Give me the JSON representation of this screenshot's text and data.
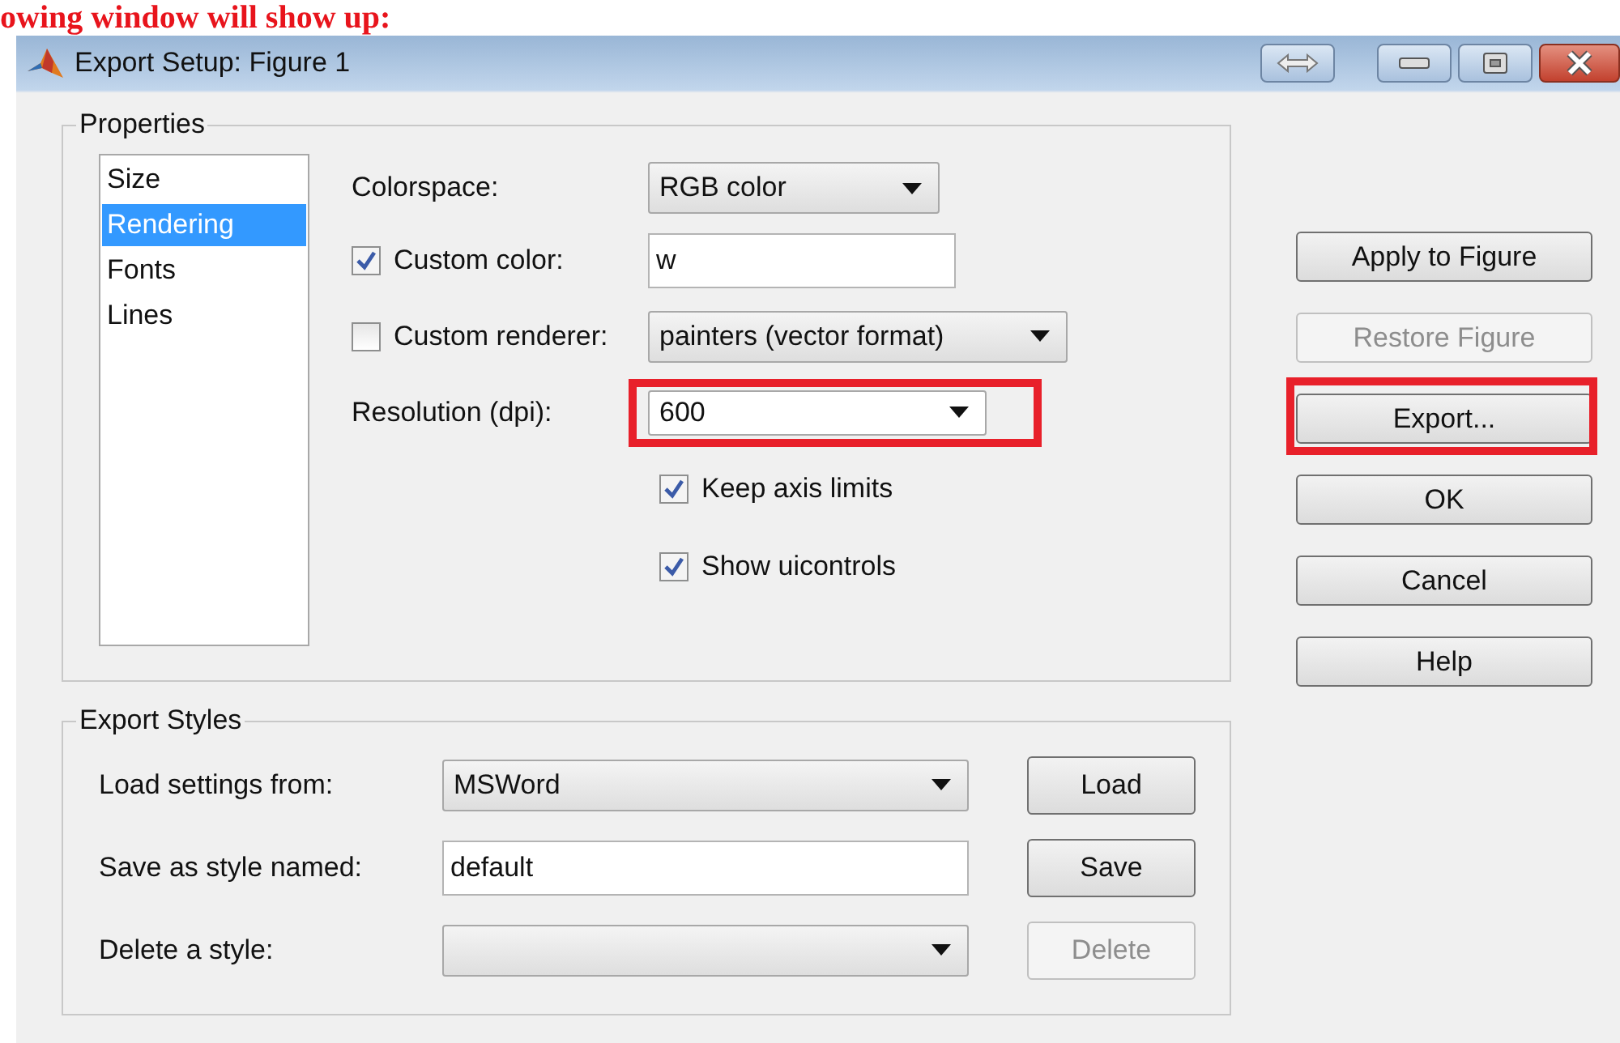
{
  "caption": "owing window will show up:",
  "window": {
    "title": "Export Setup: Figure 1"
  },
  "properties": {
    "title": "Properties",
    "categories": [
      {
        "label": "Size",
        "selected": false
      },
      {
        "label": "Rendering",
        "selected": true
      },
      {
        "label": "Fonts",
        "selected": false
      },
      {
        "label": "Lines",
        "selected": false
      }
    ],
    "fields": [
      {
        "kind": "dropdown",
        "label": "Colorspace:",
        "value": "RGB color",
        "highlighted": false
      },
      {
        "kind": "checkbox-text",
        "label": "Custom color:",
        "checked": true,
        "value": "w",
        "highlighted": false
      },
      {
        "kind": "checkbox-dropdown",
        "label": "Custom renderer:",
        "checked": false,
        "value": "painters (vector format)",
        "highlighted": false
      },
      {
        "kind": "dropdown",
        "label": "Resolution (dpi):",
        "value": "600",
        "highlighted": true
      }
    ],
    "options": [
      {
        "label": "Keep axis limits",
        "checked": true
      },
      {
        "label": "Show uicontrols",
        "checked": true
      }
    ]
  },
  "actions": [
    {
      "label": "Apply to Figure",
      "disabled": false,
      "highlighted": false
    },
    {
      "label": "Restore Figure",
      "disabled": true,
      "highlighted": false
    },
    {
      "label": "Export...",
      "disabled": false,
      "highlighted": true
    },
    {
      "label": "OK",
      "disabled": false,
      "highlighted": false
    },
    {
      "label": "Cancel",
      "disabled": false,
      "highlighted": false
    },
    {
      "label": "Help",
      "disabled": false,
      "highlighted": false
    }
  ],
  "export_styles": {
    "title": "Export Styles",
    "rows": [
      {
        "kind": "dropdown",
        "label": "Load settings from:",
        "value": "MSWord",
        "button": {
          "label": "Load",
          "disabled": false
        }
      },
      {
        "kind": "text",
        "label": "Save as style named:",
        "value": "default",
        "button": {
          "label": "Save",
          "disabled": false
        }
      },
      {
        "kind": "dropdown",
        "label": "Delete a style:",
        "button": {
          "label": "Delete",
          "disabled": true
        }
      }
    ]
  }
}
